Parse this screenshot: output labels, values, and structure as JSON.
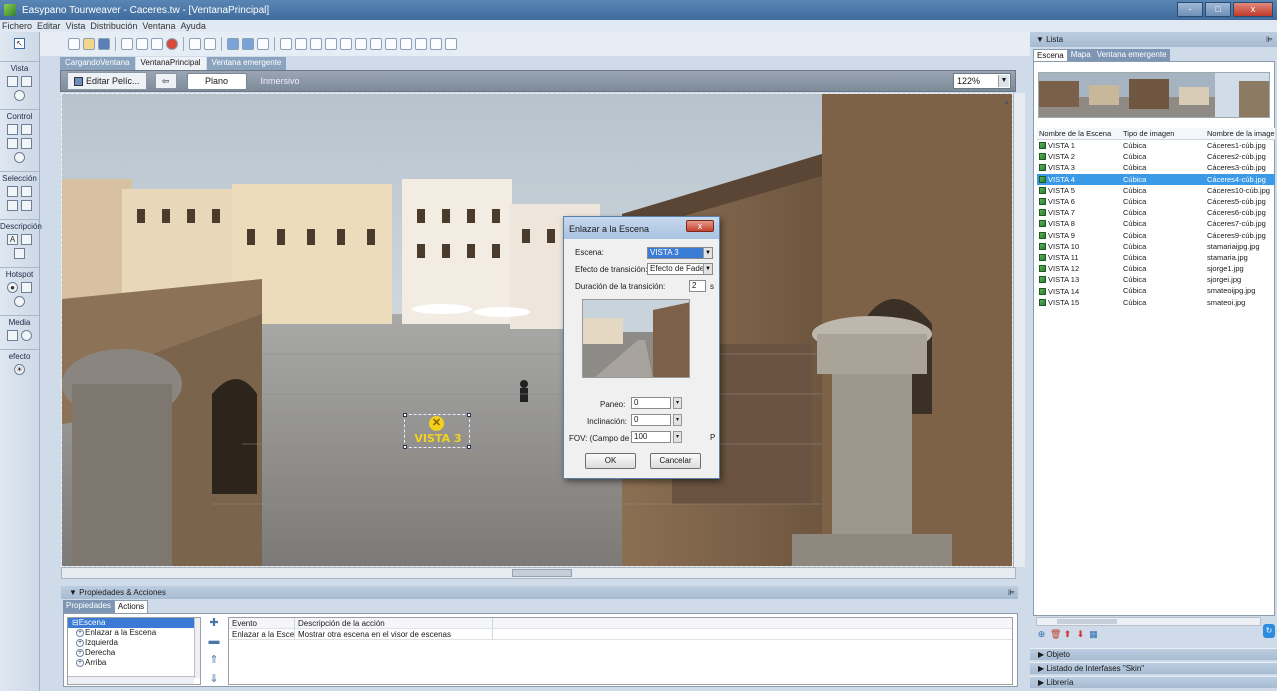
{
  "window": {
    "title": "Easypano Tourweaver - Caceres.tw - [VentanaPrincipal]",
    "controls": [
      "-",
      "□",
      "x"
    ]
  },
  "menu": [
    "Fichero",
    "Editar",
    "Vista",
    "Distribución",
    "Ventana",
    "Ayuda"
  ],
  "toolbox": {
    "groups": [
      {
        "label": "Vista"
      },
      {
        "label": "Control"
      },
      {
        "label": "Selección"
      },
      {
        "label": "Descripción"
      },
      {
        "label": "Hotspot"
      },
      {
        "label": "Media"
      },
      {
        "label": "efecto"
      }
    ]
  },
  "doc_tabs": [
    "CargandoVentana",
    "VentanaPrincipal",
    "Ventana emergente"
  ],
  "viewbar": {
    "edit_label": "Editar Pelíc...",
    "back_label": "⇦",
    "plano_label": "Plano",
    "inmersivo_label": "Inmersivo",
    "zoom": "122%"
  },
  "hotspot": {
    "label": "VISTA 3",
    "icon_glyph": "✕"
  },
  "dialog": {
    "title": "Enlazar a la Escena",
    "close": "x",
    "escena_label": "Escena:",
    "escena_value": "VISTA 3",
    "efecto_label": "Efecto de transición:",
    "efecto_value": "Efecto de Fade I",
    "duracion_label": "Duración de la transición:",
    "duracion_value": "2",
    "duracion_unit": "s",
    "paneo_label": "Paneo:",
    "paneo_value": "0",
    "inclinacion_label": "Inclinación:",
    "inclinacion_value": "0",
    "fov_label": "FOV: (Campo de",
    "fov_value": "100",
    "fov_suffix": "P",
    "ok_label": "OK",
    "cancel_label": "Cancelar"
  },
  "props": {
    "header": "Propiedades & Acciones",
    "tabs": [
      "Propiedades",
      "Actions"
    ],
    "tree": [
      {
        "label": "Escena",
        "selected": true
      },
      {
        "label": "Enlazar a la Escena"
      },
      {
        "label": "Izquierda"
      },
      {
        "label": "Derecha"
      },
      {
        "label": "Arriba"
      }
    ],
    "grid_headers": [
      "Evento",
      "Descripción de la acción"
    ],
    "grid_rows": [
      {
        "evento": "Enlazar a la Escena",
        "descripcion": "Mostrar otra escena en el visor de escenas"
      }
    ]
  },
  "right_panel": {
    "header": "Lista",
    "tabs": [
      "Escena",
      "Mapa",
      "Ventana emergente"
    ],
    "columns": [
      "Nombre de la Escena",
      "Tipo de imagen",
      "Nombre de la imagen"
    ],
    "scenes": [
      {
        "name": "VISTA 1",
        "type": "Cúbica",
        "image": "Cáceres1-cúb.jpg"
      },
      {
        "name": "VISTA 2",
        "type": "Cúbica",
        "image": "Cáceres2-cúb.jpg"
      },
      {
        "name": "VISTA 3",
        "type": "Cúbica",
        "image": "Cáceres3-cúb.jpg"
      },
      {
        "name": "VISTA 4",
        "type": "Cúbica",
        "image": "Cáceres4-cúb.jpg",
        "selected": true
      },
      {
        "name": "VISTA 5",
        "type": "Cúbica",
        "image": "Cáceres10-cúb.jpg"
      },
      {
        "name": "VISTA 6",
        "type": "Cúbica",
        "image": "Cáceres5-cúb.jpg"
      },
      {
        "name": "VISTA 7",
        "type": "Cúbica",
        "image": "Cáceres6-cúb.jpg"
      },
      {
        "name": "VISTA 8",
        "type": "Cúbica",
        "image": "Cáceres7-cúb.jpg"
      },
      {
        "name": "VISTA 9",
        "type": "Cúbica",
        "image": "Cáceres9-cúb.jpg"
      },
      {
        "name": "VISTA 10",
        "type": "Cúbica",
        "image": "stamariaijpg.jpg"
      },
      {
        "name": "VISTA 11",
        "type": "Cúbica",
        "image": "stamaria.jpg"
      },
      {
        "name": "VISTA 12",
        "type": "Cúbica",
        "image": "sjorge1.jpg"
      },
      {
        "name": "VISTA 13",
        "type": "Cúbica",
        "image": "sjorgei.jpg"
      },
      {
        "name": "VISTA 14",
        "type": "Cúbica",
        "image": "smateoijpg.jpg"
      },
      {
        "name": "VISTA 15",
        "type": "Cúbica",
        "image": "smateoi.jpg"
      }
    ],
    "sections": [
      "Objeto",
      "Listado de Interfases \"Skin\"",
      "Librería"
    ]
  }
}
